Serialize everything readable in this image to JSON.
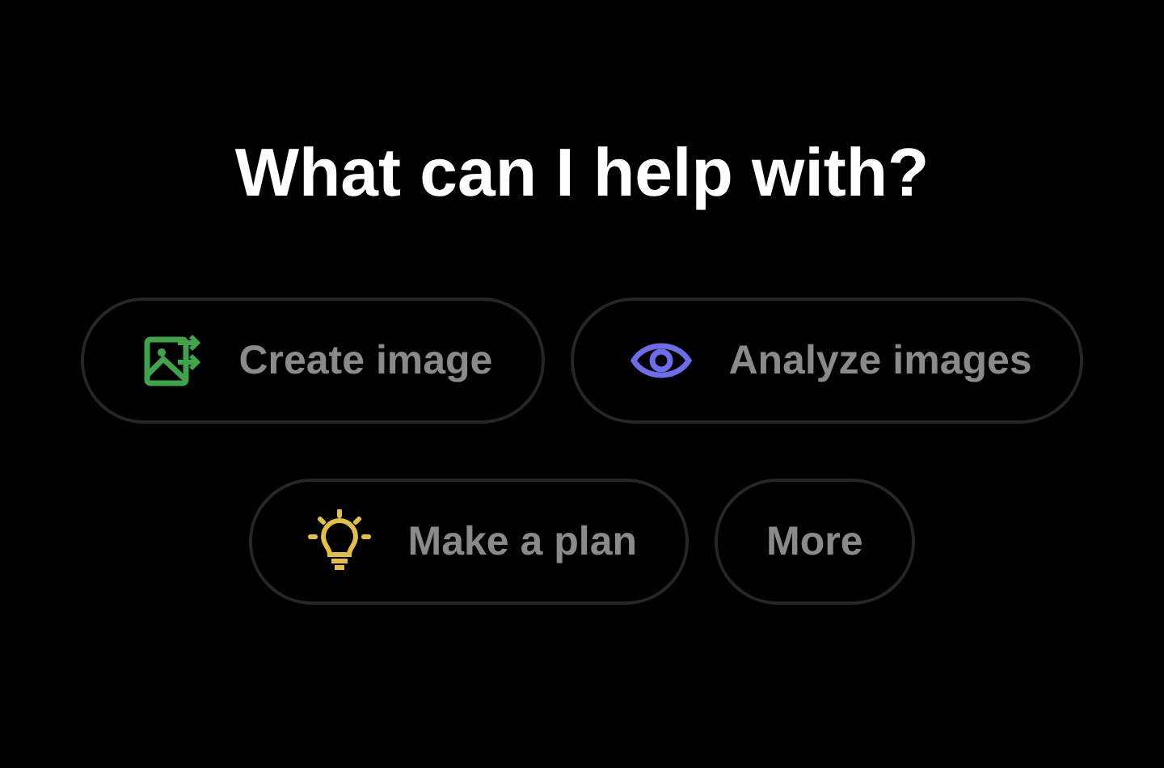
{
  "heading": "What can I help with?",
  "rows": [
    [
      {
        "label": "Create image",
        "kind": "image",
        "color": "#3fa34d"
      },
      {
        "label": "Analyze images",
        "kind": "eye",
        "color": "#6e6ce8"
      }
    ],
    [
      {
        "label": "Make a plan",
        "kind": "bulb",
        "color": "#e2c043"
      },
      {
        "label": "More",
        "kind": "none"
      }
    ]
  ]
}
